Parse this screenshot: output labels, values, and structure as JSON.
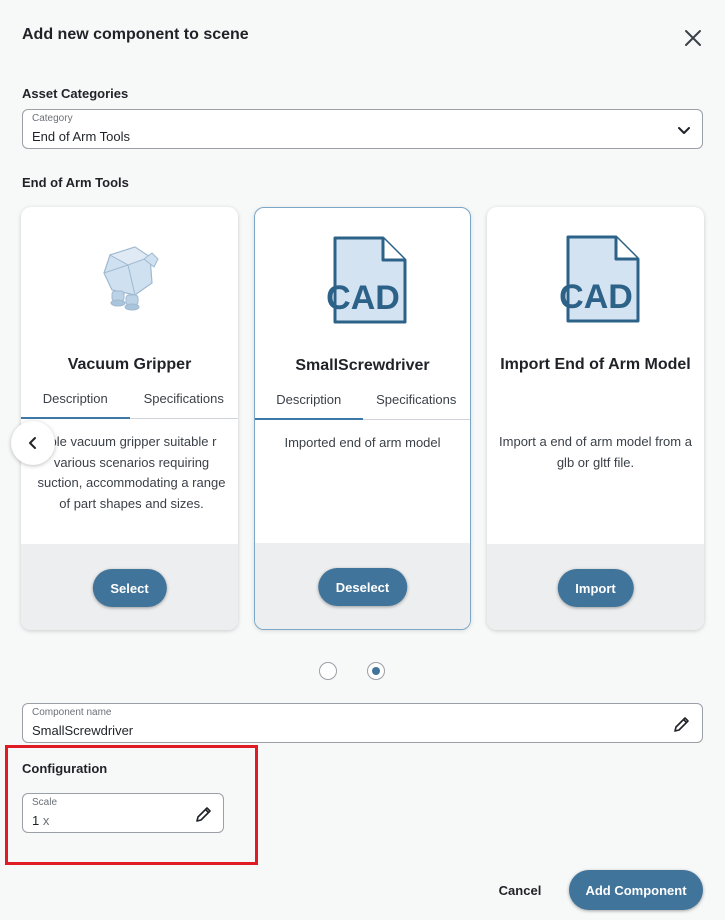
{
  "dialog": {
    "title": "Add new component to scene"
  },
  "asset_categories": {
    "heading": "Asset Categories",
    "category_label": "Category",
    "category_value": "End of Arm Tools"
  },
  "tools_section": {
    "heading": "End of Arm Tools"
  },
  "cards": [
    {
      "title": "Vacuum Gripper",
      "tab_description": "Description",
      "tab_specifications": "Specifications",
      "description": "ible vacuum gripper suitable r various scenarios requiring suction, accommodating a range of part shapes and sizes.",
      "button": "Select"
    },
    {
      "title": "SmallScrewdriver",
      "thumb_text": "CAD",
      "tab_description": "Description",
      "tab_specifications": "Specifications",
      "description": "Imported end of arm model",
      "button": "Deselect"
    },
    {
      "title": "Import End of Arm Model",
      "thumb_text": "CAD",
      "description": "Import a end of arm model from a glb or gltf file.",
      "button": "Import"
    }
  ],
  "pagination": {
    "pages": 2,
    "current": 2
  },
  "component_name": {
    "label": "Component name",
    "value": "SmallScrewdriver"
  },
  "configuration": {
    "heading": "Configuration",
    "scale_label": "Scale",
    "scale_value": "1",
    "scale_unit": "x"
  },
  "actions": {
    "cancel": "Cancel",
    "add": "Add Component"
  },
  "colors": {
    "accent": "#41749a",
    "highlight": "#e01b24",
    "cad_fill": "#d3e3f2",
    "cad_text": "#2d6288"
  }
}
